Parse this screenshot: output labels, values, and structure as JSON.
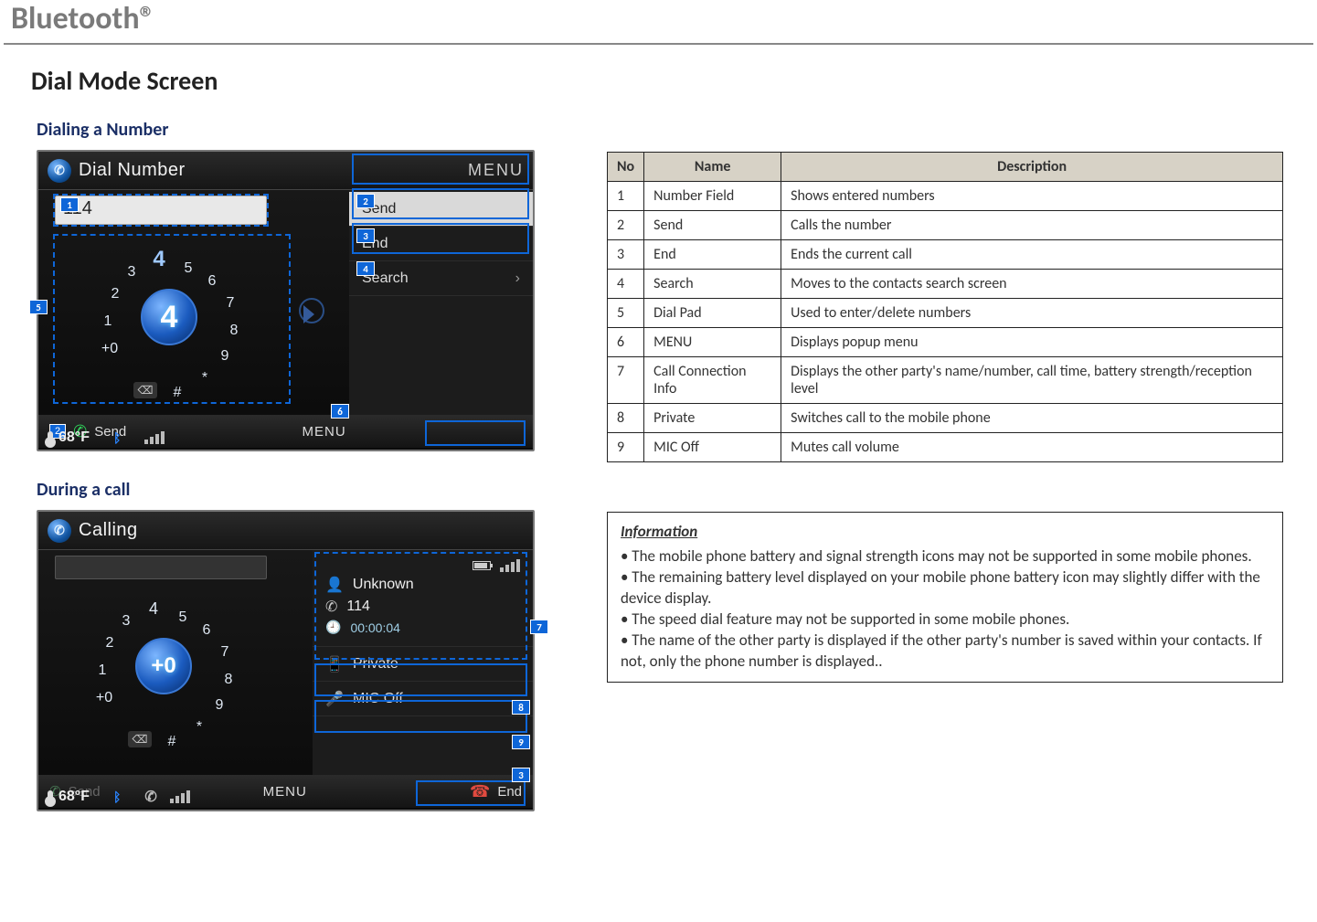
{
  "page": {
    "title": "Bluetooth®",
    "section": "Dial Mode Screen",
    "sub1": "Dialing a Number",
    "sub2": "During a call"
  },
  "dial_shot": {
    "header": "Dial Number",
    "menu_label": "MENU",
    "number_entered": "114",
    "send": "Send",
    "end": "End",
    "search": "Search",
    "center_digit": "4",
    "bottom_send_num": "2",
    "bottom_send": "Send",
    "bottom_menu": "MENU",
    "temp": "68°F",
    "badges": {
      "b1": "1",
      "b2": "2",
      "b3": "3",
      "b4": "4",
      "b5": "5",
      "b6": "6",
      "bSend": "2"
    }
  },
  "call_shot": {
    "header": "Calling",
    "unknown": "Unknown",
    "number": "114",
    "time": "00:00:04",
    "private": "Private",
    "mic_off": "MIC Off",
    "send": "Send",
    "menu": "MENU",
    "end": "End",
    "center_digit": "+0",
    "temp": "68°F",
    "badges": {
      "b7": "7",
      "b8": "8",
      "b9": "9",
      "b3": "3"
    }
  },
  "table": {
    "headers": {
      "no": "No",
      "name": "Name",
      "desc": "Description"
    },
    "rows": [
      {
        "no": "1",
        "name": "Number Field",
        "desc": "Shows entered numbers"
      },
      {
        "no": "2",
        "name": "Send",
        "desc": "Calls the number"
      },
      {
        "no": "3",
        "name": "End",
        "desc": "Ends the current call"
      },
      {
        "no": "4",
        "name": "Search",
        "desc": "Moves to the contacts search screen"
      },
      {
        "no": "5",
        "name": "Dial Pad",
        "desc": "Used to enter/delete numbers"
      },
      {
        "no": "6",
        "name": "MENU",
        "desc": "Displays popup menu"
      },
      {
        "no": "7",
        "name": "Call Connection Info",
        "desc": "Displays the other party's name/number, call time, battery strength/reception level"
      },
      {
        "no": "8",
        "name": "Private",
        "desc": "Switches call to the mobile phone"
      },
      {
        "no": "9",
        "name": "MIC Off",
        "desc": "Mutes call volume"
      }
    ]
  },
  "info": {
    "heading": "Information",
    "lines": [
      "• The mobile phone battery and signal strength icons may not be supported in some mobile phones.",
      "• The remaining battery level displayed on your mobile phone battery icon may slightly differ with the device display.",
      "• The speed dial feature may not be supported in some mobile phones.",
      "• The name of the other party is displayed if the other party's number is saved within your contacts. If not, only the phone number is displayed.."
    ]
  }
}
